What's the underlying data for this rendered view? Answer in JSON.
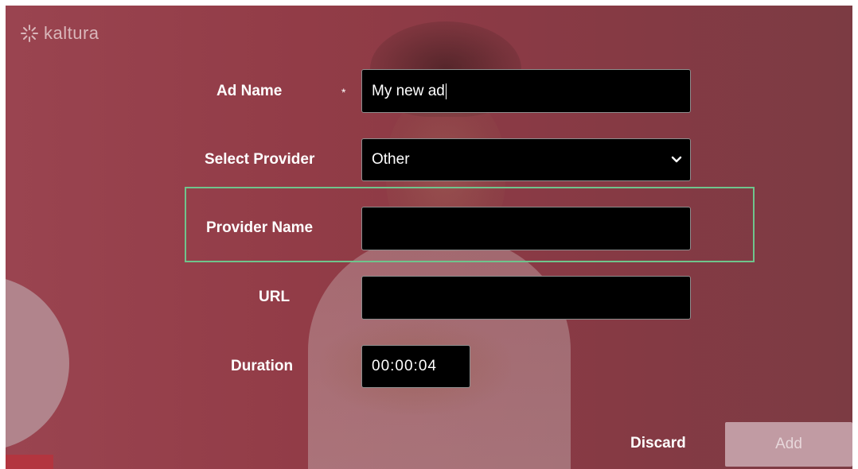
{
  "brand": {
    "name": "kaltura",
    "icon": "kaltura-logo-icon"
  },
  "form": {
    "ad_name": {
      "label": "Ad Name",
      "required_mark": "*",
      "value": "My new ad"
    },
    "provider": {
      "label": "Select Provider",
      "selected": "Other",
      "icon": "chevron-down-icon"
    },
    "provider_name": {
      "label": "Provider Name",
      "value": ""
    },
    "url": {
      "label": "URL",
      "value": ""
    },
    "duration": {
      "label": "Duration",
      "value": "00:00:04"
    }
  },
  "actions": {
    "discard_label": "Discard",
    "add_label": "Add"
  },
  "colors": {
    "background": "#923c47",
    "field_bg": "#000000",
    "highlight_border": "#6fc48c",
    "add_button_bg": "#c19ba3"
  }
}
